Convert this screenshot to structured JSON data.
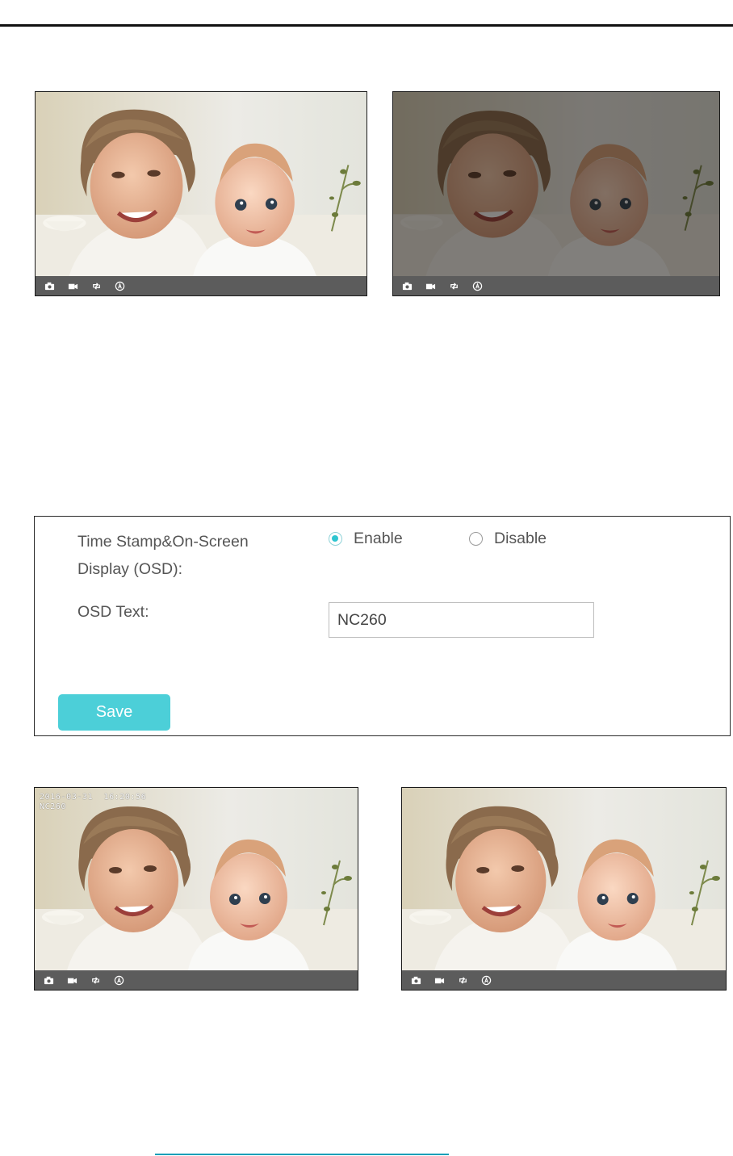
{
  "preview_images": [
    {
      "id": "top-left",
      "overlay_lines": []
    },
    {
      "id": "top-right",
      "overlay_lines": []
    },
    {
      "id": "bottom-left",
      "overlay_lines": [
        "2016-03-31  16:20:56",
        "NC260"
      ]
    },
    {
      "id": "bottom-right",
      "overlay_lines": []
    }
  ],
  "toolbar_icons": [
    "camera-icon",
    "video-icon",
    "rotate-icon",
    "auto-icon"
  ],
  "settings": {
    "timestamp_label": "Time Stamp&On-Screen Display (OSD):",
    "enable_label": "Enable",
    "disable_label": "Disable",
    "selected": "Enable",
    "osd_text_label": "OSD Text:",
    "osd_text_value": "NC260",
    "save_label": "Save"
  },
  "colors": {
    "accent": "#4ccfd8",
    "radio_selected": "#2ec5d0",
    "toolbar": "#5c5c5c",
    "link_rule": "#1a9fb8"
  }
}
